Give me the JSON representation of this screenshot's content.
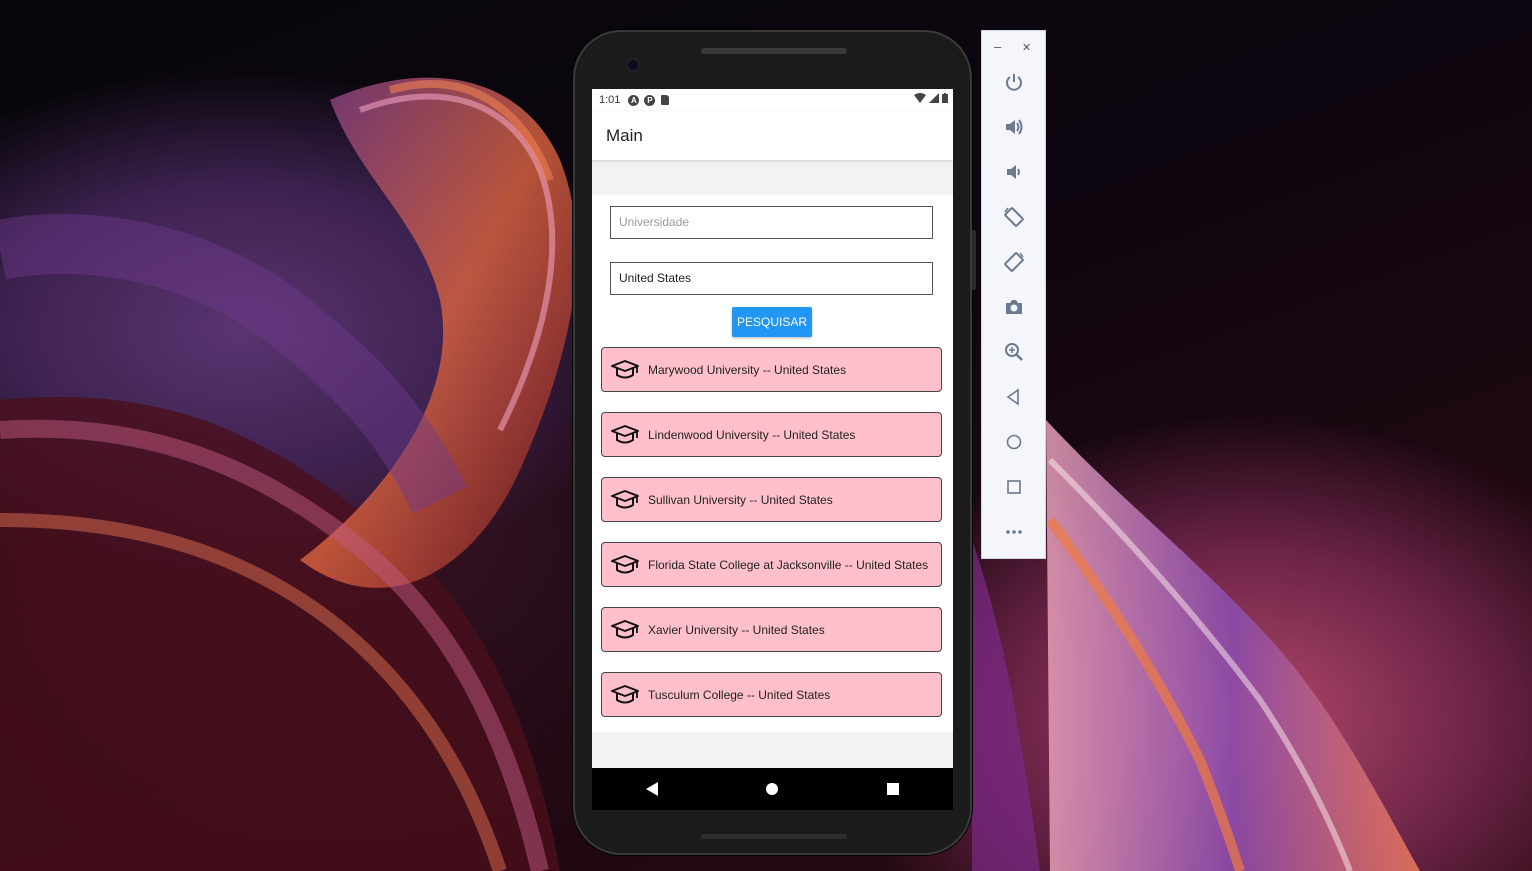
{
  "emulator": {
    "toolbar": {
      "minimize_glyph": "–",
      "close_glyph": "✕",
      "buttons": [
        {
          "name": "power-icon"
        },
        {
          "name": "volume-up-icon"
        },
        {
          "name": "volume-down-icon"
        },
        {
          "name": "rotate-left-icon"
        },
        {
          "name": "rotate-right-icon"
        },
        {
          "name": "camera-icon"
        },
        {
          "name": "zoom-icon"
        },
        {
          "name": "back-icon"
        },
        {
          "name": "home-icon"
        },
        {
          "name": "overview-icon"
        },
        {
          "name": "more-icon"
        }
      ]
    }
  },
  "status_bar": {
    "time": "1:01",
    "notif_icons": [
      "A",
      "P"
    ]
  },
  "app": {
    "title": "Main",
    "search": {
      "university_placeholder": "Universidade",
      "university_value": "",
      "country_value": "United States",
      "button_label": "PESQUISAR"
    },
    "results": [
      {
        "label": "Marywood University -- United States"
      },
      {
        "label": "Lindenwood University -- United States"
      },
      {
        "label": "Sullivan University -- United States"
      },
      {
        "label": "Florida State College at Jacksonville -- United States"
      },
      {
        "label": "Xavier University -- United States"
      },
      {
        "label": "Tusculum College -- United States"
      }
    ]
  },
  "colors": {
    "button": "#2196f3",
    "card": "#ffc0cb",
    "toolbar_icon": "#6b7a90"
  }
}
